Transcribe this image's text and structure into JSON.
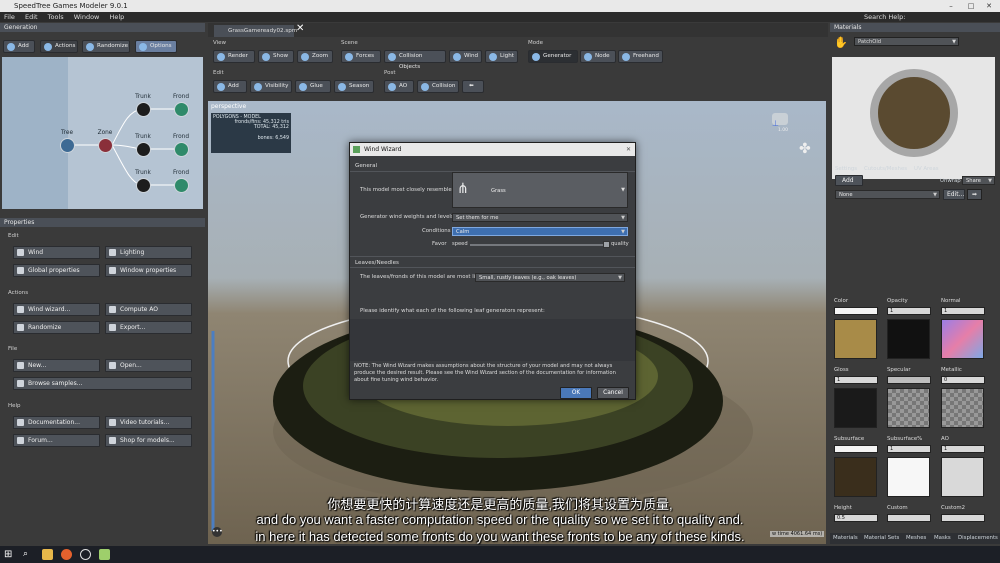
{
  "window": {
    "title": "SpeedTree Games Modeler 9.0.1",
    "search_help": "Search Help:"
  },
  "menu": [
    "File",
    "Edit",
    "Tools",
    "Window",
    "Help"
  ],
  "generation": {
    "title": "Generation",
    "buttons": [
      "Add",
      "Actions",
      "Randomize",
      "Options"
    ],
    "nodes": [
      "Tree",
      "Zone",
      "Trunk",
      "Frond",
      "Trunk",
      "Frond",
      "Trunk",
      "Frond"
    ]
  },
  "properties": {
    "title": "Properties",
    "edit_label": "Edit",
    "edit_buttons": [
      "Wind",
      "Lighting",
      "Global properties",
      "Window properties"
    ],
    "actions_label": "Actions",
    "action_buttons": [
      "Wind wizard...",
      "Compute AO",
      "Randomize",
      "Export..."
    ],
    "file_label": "File",
    "file_buttons": [
      "New...",
      "Open...",
      "Browse samples..."
    ],
    "help_label": "Help",
    "help_buttons": [
      "Documentation...",
      "Video tutorials...",
      "Forum...",
      "Shop for models..."
    ]
  },
  "document_tab": "GrassGameready02.spm",
  "toolbar": {
    "view_label": "View",
    "view": [
      "Render",
      "Show",
      "Zoom"
    ],
    "scene_label": "Scene",
    "scene": [
      "Forces",
      "Collision Objects",
      "Wind",
      "Light"
    ],
    "mode_label": "Mode",
    "mode": [
      "Generator",
      "Node",
      "Freehand"
    ],
    "edit_label": "Edit",
    "edit": [
      "Add",
      "Visibility",
      "Glue",
      "Season"
    ],
    "post_label": "Post",
    "post": [
      "AO",
      "Collision"
    ]
  },
  "viewport": {
    "name": "perspective",
    "stats_title": "POLYGONS - MODEL",
    "stats": [
      [
        "fronds/fins:",
        "45,312 tris"
      ],
      [
        "TOTAL:",
        "45,312"
      ],
      [
        "bones:",
        "6,549"
      ]
    ],
    "zoom_label": "1.00",
    "render_time": "w time 4061.64 ms)"
  },
  "wind_wizard": {
    "title": "Wind Wizard",
    "general_label": "General",
    "resembles_label": "This model most closely resembles a",
    "resembles_value": "Grass",
    "weights_label": "Generator wind weights and levels",
    "weights_value": "Set them for me",
    "conditions_label": "Conditions",
    "conditions_value": "Calm",
    "favor_label": "Favor",
    "favor_left": "speed",
    "favor_right": "quality",
    "favor_level": 0.98,
    "leaves_label": "Leaves/Needles",
    "leaves_question": "The leaves/fronds of this model are most like",
    "leaves_value": "Small, rustly leaves (e.g., oak leaves)",
    "identify_text": "Please identify what each of the following leaf generators represent:",
    "note": "NOTE:  The Wind Wizard makes assumptions about the structure of your model and may not always produce the desired result.  Please see the Wind Wizard section of the documentation for information about fine tuning wind behavior.",
    "ok": "OK",
    "cancel": "Cancel"
  },
  "materials": {
    "title": "Materials",
    "material_name": "PatchOld",
    "tabs": [
      "Settings",
      "Cutouts/Meshes",
      "UV Areas"
    ],
    "unwrap_label": "Unwrap",
    "unwrap_value": "Share",
    "add_button": "Add",
    "none_value": "None",
    "edit_button": "Edit...",
    "swatches": [
      {
        "label": "Color",
        "value": ""
      },
      {
        "label": "Opacity",
        "value": "1"
      },
      {
        "label": "Normal",
        "value": "1"
      },
      {
        "label": "Gloss",
        "value": "1"
      },
      {
        "label": "Specular",
        "value": ""
      },
      {
        "label": "Metallic",
        "value": "0"
      },
      {
        "label": "Subsurface",
        "value": ""
      },
      {
        "label": "Subsurface%",
        "value": "1"
      },
      {
        "label": "AO",
        "value": "1"
      }
    ],
    "height_label": "Height",
    "height_value": "0.5",
    "custom_label": "Custom",
    "custom2_label": "Custom2",
    "bottom_tabs": [
      "Materials",
      "Material Sets",
      "Meshes",
      "Masks",
      "Displacements"
    ]
  },
  "subtitles": {
    "zh": "你想要更快的计算速度还是更高的质量,我们将其设置为质量,",
    "en1": "and do you want a faster computation speed or the quality so we set it to quality and.",
    "en2": "in here it has detected some fronts do you want these fronts to be any of these kinds."
  },
  "colors": {
    "accent": "#5b86c4",
    "panel": "#3a3a3a",
    "header": "#4a4f57",
    "grid_sky": "#9fb1c7"
  }
}
